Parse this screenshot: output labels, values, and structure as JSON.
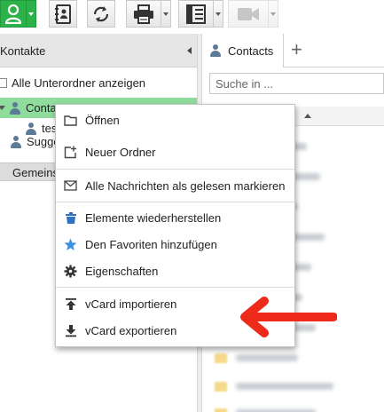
{
  "toolbar": {
    "buttons": [
      {
        "icon": "contact-person-icon",
        "has_dropdown": true,
        "accent": "#2db24a"
      },
      {
        "icon": "address-book-icon",
        "has_dropdown": false
      },
      {
        "icon": "sync-icon",
        "has_dropdown": false
      },
      {
        "icon": "printer-icon",
        "has_dropdown": true
      },
      {
        "icon": "layout-columns-icon",
        "has_dropdown": true
      },
      {
        "icon": "video-camera-icon",
        "has_dropdown": true,
        "disabled": true
      }
    ]
  },
  "left_panel": {
    "title": "Kontakte",
    "show_subfolders_label": "Alle Unterordner anzeigen",
    "tree": [
      {
        "label": "Contacts",
        "selected": true,
        "expanded": true
      },
      {
        "label": "test",
        "selected": false
      },
      {
        "label": "Suggested Contacts",
        "selected": false
      }
    ],
    "shared_section_label": "Gemeinsame Kontakte"
  },
  "right_panel": {
    "tab_label": "Contacts",
    "add_tab_label": "+",
    "search_placeholder": "Suche in ..."
  },
  "context_menu": {
    "items": [
      {
        "label": "Öffnen",
        "icon": "folder-open-icon"
      },
      {
        "label": "Neuer Ordner",
        "icon": "new-folder-icon"
      },
      {
        "label": "Alle Nachrichten als gelesen markieren",
        "icon": "envelope-icon"
      },
      {
        "label": "Elemente wiederherstellen",
        "icon": "restore-items-icon"
      },
      {
        "label": "Den Favoriten hinzufügen",
        "icon": "star-icon"
      },
      {
        "label": "Eigenschaften",
        "icon": "gear-icon"
      },
      {
        "label": "vCard importieren",
        "icon": "upload-icon"
      },
      {
        "label": "vCard exportieren",
        "icon": "download-icon"
      }
    ]
  },
  "annotation": {
    "icon": "red-arrow-pointer-icon",
    "color": "#ee2a1a"
  },
  "colors": {
    "accent_green": "#2db24a",
    "selection_green": "#8fdc9c",
    "star_blue": "#3d8fe0",
    "restore_blue": "#2f72c4"
  }
}
